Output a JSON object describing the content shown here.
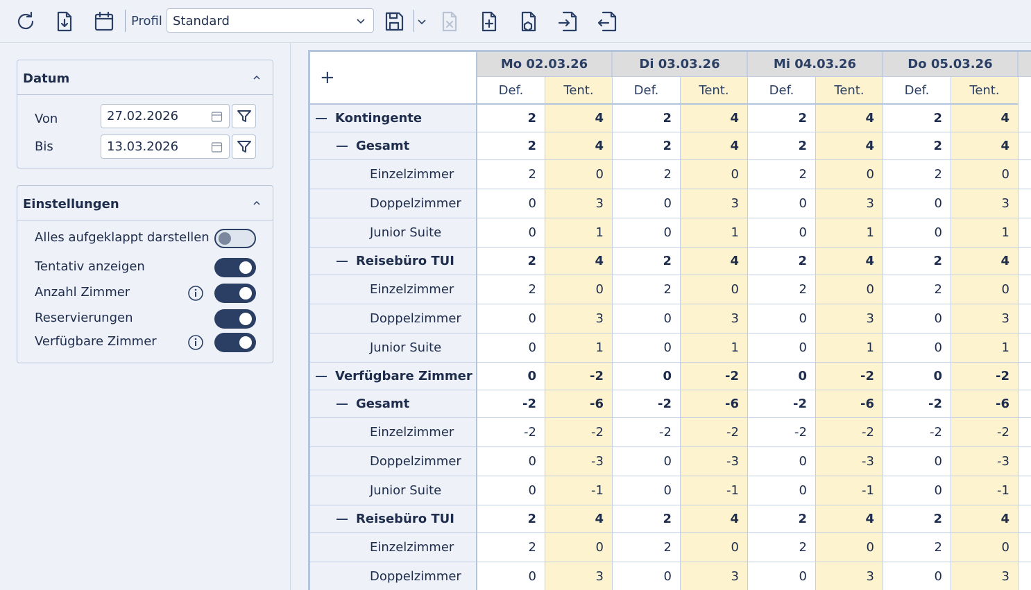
{
  "toolbar": {
    "icons": [
      "refresh-icon",
      "download-icon",
      "calendar-icon",
      "save-icon",
      "chevron-down-icon",
      "delete-file-icon",
      "add-file-icon",
      "file-package-icon",
      "import-icon",
      "export-icon"
    ],
    "profil_label": "Profil",
    "profil_value": "Standard"
  },
  "datum": {
    "title": "Datum",
    "von_label": "Von",
    "von_value": "27.02.2026",
    "bis_label": "Bis",
    "bis_value": "13.03.2026"
  },
  "einstellungen": {
    "title": "Einstellungen",
    "items": [
      {
        "label": "Alles aufgeklappt darstellen",
        "on": false,
        "info": false
      },
      {
        "label": "Tentativ anzeigen",
        "on": true,
        "info": false
      },
      {
        "label": "Anzahl Zimmer",
        "on": true,
        "info": true
      },
      {
        "label": "Reservierungen",
        "on": true,
        "info": false
      },
      {
        "label": "Verfügbare Zimmer",
        "on": true,
        "info": true
      }
    ]
  },
  "grid": {
    "add_label": "+",
    "dates": [
      "Mo 02.03.26",
      "Di 03.03.26",
      "Mi 04.03.26",
      "Do 05.03.26"
    ],
    "sub_def": "Def.",
    "sub_tent": "Tent.",
    "rows": [
      {
        "label": "Kontingente",
        "level": 0,
        "bold": true,
        "values": [
          "2",
          "4",
          "2",
          "4",
          "2",
          "4",
          "2",
          "4"
        ]
      },
      {
        "label": "Gesamt",
        "level": 1,
        "bold": true,
        "values": [
          "2",
          "4",
          "2",
          "4",
          "2",
          "4",
          "2",
          "4"
        ]
      },
      {
        "label": "Einzelzimmer",
        "level": 2,
        "bold": false,
        "values": [
          "2",
          "0",
          "2",
          "0",
          "2",
          "0",
          "2",
          "0"
        ]
      },
      {
        "label": "Doppelzimmer",
        "level": 2,
        "bold": false,
        "values": [
          "0",
          "3",
          "0",
          "3",
          "0",
          "3",
          "0",
          "3"
        ]
      },
      {
        "label": "Junior Suite",
        "level": 2,
        "bold": false,
        "values": [
          "0",
          "1",
          "0",
          "1",
          "0",
          "1",
          "0",
          "1"
        ]
      },
      {
        "label": "Reisebüro TUI",
        "level": 1,
        "bold": true,
        "values": [
          "2",
          "4",
          "2",
          "4",
          "2",
          "4",
          "2",
          "4"
        ]
      },
      {
        "label": "Einzelzimmer",
        "level": 2,
        "bold": false,
        "values": [
          "2",
          "0",
          "2",
          "0",
          "2",
          "0",
          "2",
          "0"
        ]
      },
      {
        "label": "Doppelzimmer",
        "level": 2,
        "bold": false,
        "values": [
          "0",
          "3",
          "0",
          "3",
          "0",
          "3",
          "0",
          "3"
        ]
      },
      {
        "label": "Junior Suite",
        "level": 2,
        "bold": false,
        "values": [
          "0",
          "1",
          "0",
          "1",
          "0",
          "1",
          "0",
          "1"
        ]
      },
      {
        "label": "Verfügbare Zimmer",
        "level": 0,
        "bold": true,
        "values": [
          "0",
          "-2",
          "0",
          "-2",
          "0",
          "-2",
          "0",
          "-2"
        ]
      },
      {
        "label": "Gesamt",
        "level": 1,
        "bold": true,
        "values": [
          "-2",
          "-6",
          "-2",
          "-6",
          "-2",
          "-6",
          "-2",
          "-6"
        ]
      },
      {
        "label": "Einzelzimmer",
        "level": 2,
        "bold": false,
        "values": [
          "-2",
          "-2",
          "-2",
          "-2",
          "-2",
          "-2",
          "-2",
          "-2"
        ]
      },
      {
        "label": "Doppelzimmer",
        "level": 2,
        "bold": false,
        "values": [
          "0",
          "-3",
          "0",
          "-3",
          "0",
          "-3",
          "0",
          "-3"
        ]
      },
      {
        "label": "Junior Suite",
        "level": 2,
        "bold": false,
        "values": [
          "0",
          "-1",
          "0",
          "-1",
          "0",
          "-1",
          "0",
          "-1"
        ]
      },
      {
        "label": "Reisebüro TUI",
        "level": 1,
        "bold": true,
        "values": [
          "2",
          "4",
          "2",
          "4",
          "2",
          "4",
          "2",
          "4"
        ]
      },
      {
        "label": "Einzelzimmer",
        "level": 2,
        "bold": false,
        "values": [
          "2",
          "0",
          "2",
          "0",
          "2",
          "0",
          "2",
          "0"
        ]
      },
      {
        "label": "Doppelzimmer",
        "level": 2,
        "bold": false,
        "values": [
          "0",
          "3",
          "0",
          "3",
          "0",
          "3",
          "0",
          "3"
        ]
      }
    ]
  }
}
